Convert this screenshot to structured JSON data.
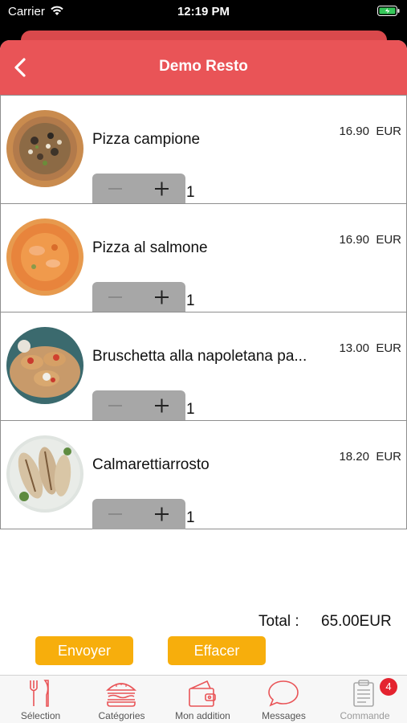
{
  "status_bar": {
    "carrier": "Carrier",
    "time": "12:19 PM"
  },
  "navbar": {
    "title": "Demo Resto"
  },
  "items": [
    {
      "name": "Pizza campione",
      "price": "16.90  EUR",
      "qty": "1"
    },
    {
      "name": " Pizza al salmone",
      "price": "16.90  EUR",
      "qty": "1"
    },
    {
      "name": "Bruschetta alla napoletana pa...",
      "price": "13.00  EUR",
      "qty": "1"
    },
    {
      "name": "Calmarettiarrosto",
      "price": "18.20  EUR",
      "qty": "1"
    }
  ],
  "total": {
    "label": "Total :",
    "value": "65.00EUR"
  },
  "actions": {
    "send_label": "Envoyer",
    "clear_label": "Effacer"
  },
  "tabs": [
    {
      "label": "Sélection",
      "icon": "fork-knife-icon"
    },
    {
      "label": "Catégories",
      "icon": "burger-icon"
    },
    {
      "label": "Mon addition",
      "icon": "wallet-icon"
    },
    {
      "label": "Messages",
      "icon": "chat-bubble-icon"
    },
    {
      "label": "Commande",
      "icon": "clipboard-icon",
      "badge": "4"
    }
  ],
  "colors": {
    "header": "#e95457",
    "button": "#f7ae0c",
    "tab_icon": "#e95457",
    "badge": "#e4232f"
  }
}
